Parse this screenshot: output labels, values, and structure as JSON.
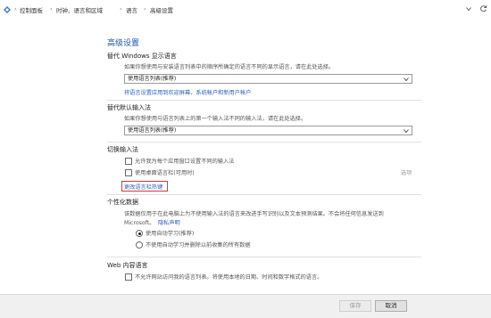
{
  "breadcrumb": {
    "items": [
      "控制面板",
      "时钟、语言和区域",
      "语言",
      "高级设置"
    ],
    "separator": "›"
  },
  "page": {
    "title": "高级设置"
  },
  "override_display_language": {
    "heading": "替代 Windows 显示语言",
    "description": "如果你想使用与安装语言列表中的顺序所确定的语言不同的显示语言，请在此处选择。",
    "select_value": "使用语言列表(推荐)",
    "apply_link": "将语言设置应用到欢迎屏幕、系统帐户和新用户帐户"
  },
  "override_input_method": {
    "heading": "替代默认输入法",
    "description": "如果你想使用与语言列表上的第一个输入法不同的输入法，请在此处选择。",
    "select_value": "使用语言列表(推荐)"
  },
  "switch_input": {
    "heading": "切换输入法",
    "checkbox1": "允许我为每个应用窗口设置不同的输入法",
    "checkbox2": "使用桌面语言栏(可用时)",
    "options_link": "选项",
    "hotkeys_link": "更改语言栏热键"
  },
  "personalization": {
    "heading": "个性化数据",
    "description_line1": "该数据仅用于在此电脑上为不使用输入法的语言来改进手写识别以及文本预测结果。不会将任何信息发送到",
    "description_line2": "Microsoft。",
    "privacy_link": "隐私声明",
    "radio1": "使用自动学习(推荐)",
    "radio2": "不使用自动学习并删除以前收集的所有数据"
  },
  "web_language": {
    "heading": "Web 内容语言",
    "checkbox": "不允许网站访问我的语言列表。将使用本地的日期、时间和数字格式的语言。"
  },
  "footer": {
    "save_label": "保存",
    "cancel_label": "取消"
  }
}
